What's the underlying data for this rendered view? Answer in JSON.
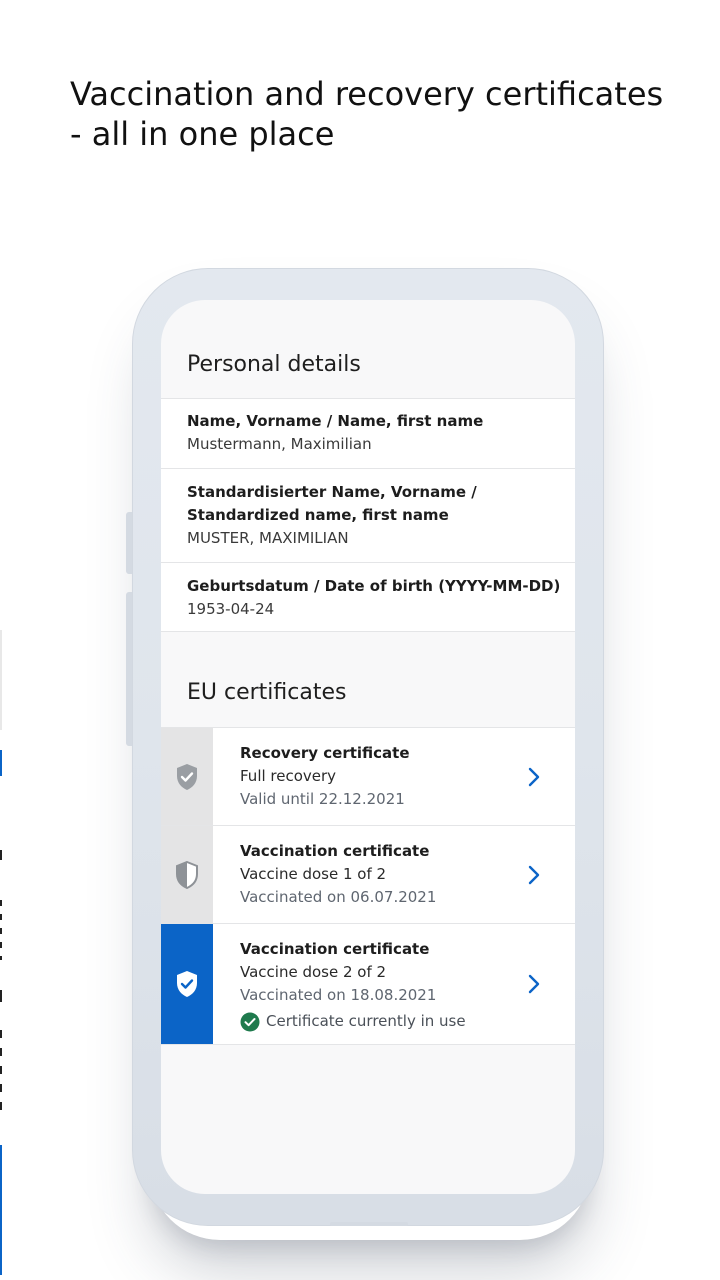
{
  "headline": "Vaccination and recovery certificates - all in one place",
  "colors": {
    "brand_blue": "#0b64c7",
    "success_green": "#1f7a4d",
    "inactive_gray": "#e4e4e5"
  },
  "personal_details": {
    "section_title": "Personal details",
    "rows": [
      {
        "label": "Name, Vorname / Name, first name",
        "value": "Mustermann, Maximilian"
      },
      {
        "label": "Standardisierter Name, Vorname / Standardized name, first name",
        "value": "MUSTER, MAXIMILIAN"
      },
      {
        "label": "Geburtsdatum / Date of birth (YYYY-MM-DD)",
        "value": "1953-04-24"
      }
    ]
  },
  "eu_certificates": {
    "section_title": "EU certificates",
    "items": [
      {
        "icon": "shield-check-icon",
        "title": "Recovery certificate",
        "subtitle": "Full recovery",
        "date_text": "Valid until 22.12.2021",
        "active": false
      },
      {
        "icon": "shield-half-icon",
        "title": "Vaccination certificate",
        "subtitle": "Vaccine dose 1 of 2",
        "date_text": "Vaccinated on 06.07.2021",
        "active": false
      },
      {
        "icon": "shield-check-icon",
        "title": "Vaccination certificate",
        "subtitle": "Vaccine dose 2 of 2",
        "date_text": "Vaccinated on 18.08.2021",
        "active": true,
        "status": "Certificate currently in use"
      }
    ]
  }
}
